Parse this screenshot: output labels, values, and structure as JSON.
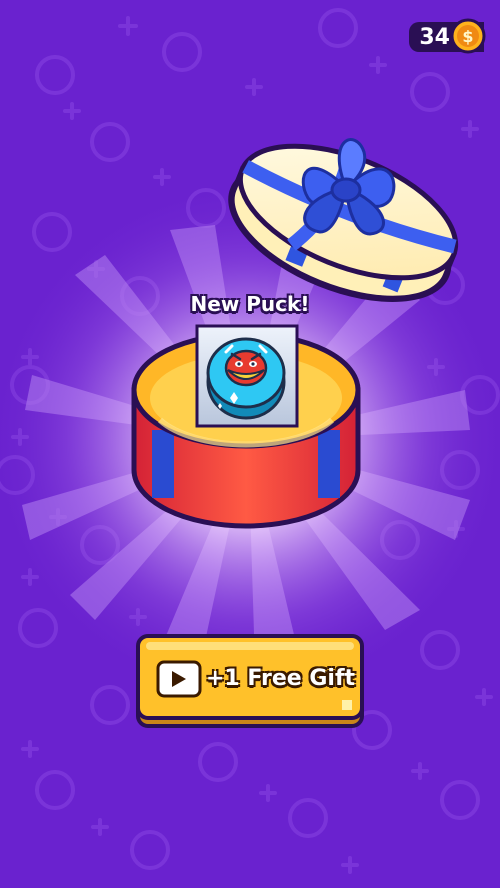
{
  "currency": {
    "amount": "34",
    "icon": "dollar-coin-icon"
  },
  "reward": {
    "title": "New Puck!",
    "item_icon": "puck-icon"
  },
  "button": {
    "label": "+1 Free Gift",
    "icon": "play-video-icon"
  },
  "colors": {
    "background": "#6a22cf",
    "box_red": "#ef3a3a",
    "box_blue": "#2a4bd1",
    "box_yellow": "#ffc93a",
    "lid_cream": "#fff1bd",
    "ribbon_blue": "#3d5ff0",
    "button_yellow": "#ffc12a",
    "puck_cyan": "#27c6f0"
  }
}
